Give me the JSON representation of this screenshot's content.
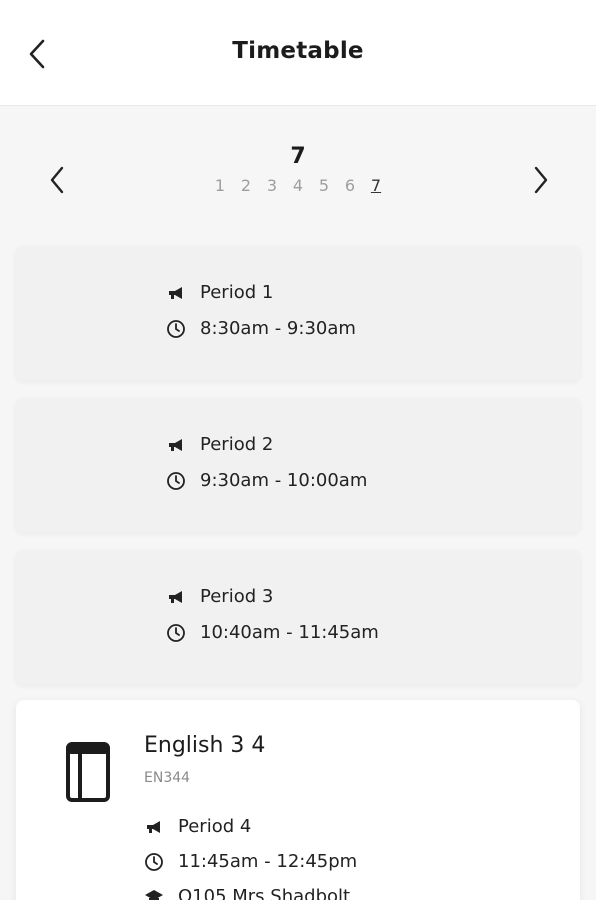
{
  "header": {
    "title": "Timetable",
    "back_icon": "chevron-left-icon"
  },
  "day_nav": {
    "current_day": "7",
    "days": [
      "1",
      "2",
      "3",
      "4",
      "5",
      "6",
      "7"
    ],
    "active_day": "7",
    "prev_icon": "chevron-left-icon",
    "next_icon": "chevron-right-icon"
  },
  "periods": [
    {
      "name": "Period 1",
      "time": "8:30am - 9:30am"
    },
    {
      "name": "Period 2",
      "time": "9:30am - 10:00am"
    },
    {
      "name": "Period 3",
      "time": "10:40am - 11:45am"
    }
  ],
  "class_card": {
    "subject": "English 3 4",
    "code": "EN344",
    "period": "Period 4",
    "time": "11:45am - 12:45pm",
    "room_teacher": "Q105 Mrs Shadbolt",
    "icon": "book-icon"
  },
  "colors": {
    "background": "#f6f6f7",
    "card": "#f1f1f2",
    "text": "#1c1c1c",
    "muted": "#9e9e9e"
  }
}
